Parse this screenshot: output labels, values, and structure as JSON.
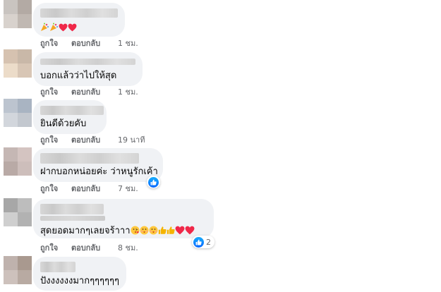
{
  "comments": [
    {
      "text": "",
      "emojis": [
        "party-popper",
        "party-popper",
        "heart",
        "heart"
      ],
      "like_label": "ถูกใจ",
      "reply_label": "ตอบกลับ",
      "time": "1 ชม."
    },
    {
      "text": "บอกแล้วว่าไปให้สุด",
      "like_label": "ถูกใจ",
      "reply_label": "ตอบกลับ",
      "time": "1 ชม."
    },
    {
      "text": "ยินดีด้วยคับ",
      "like_label": "ถูกใจ",
      "reply_label": "ตอบกลับ",
      "time": "19 นาที"
    },
    {
      "text": "ฝากบอกหน่อยค่ะ ว่าหนูรักเค้า",
      "like_label": "ถูกใจ",
      "reply_label": "ตอบกลับ",
      "time": "7 ชม.",
      "reaction": {
        "icon": "like-icon",
        "count": ""
      }
    },
    {
      "text": "สุดยอดมากๆเลยจร้าาา",
      "emojis": [
        "kiss-face",
        "kiss-face",
        "kiss-face",
        "thumbs-up",
        "thumbs-up",
        "heart",
        "heart"
      ],
      "like_label": "ถูกใจ",
      "reply_label": "ตอบกลับ",
      "time": "8 ชม.",
      "reaction": {
        "icon": "like-icon",
        "count": "2"
      }
    },
    {
      "text": "ปังงงงงงมากๆๆๆๆๆๆ"
    }
  ],
  "colors": {
    "bubble_bg": "#f0f2f5",
    "meta_text": "#65676b",
    "like_blue": "#0866ff",
    "heart_red": "#f02849"
  }
}
